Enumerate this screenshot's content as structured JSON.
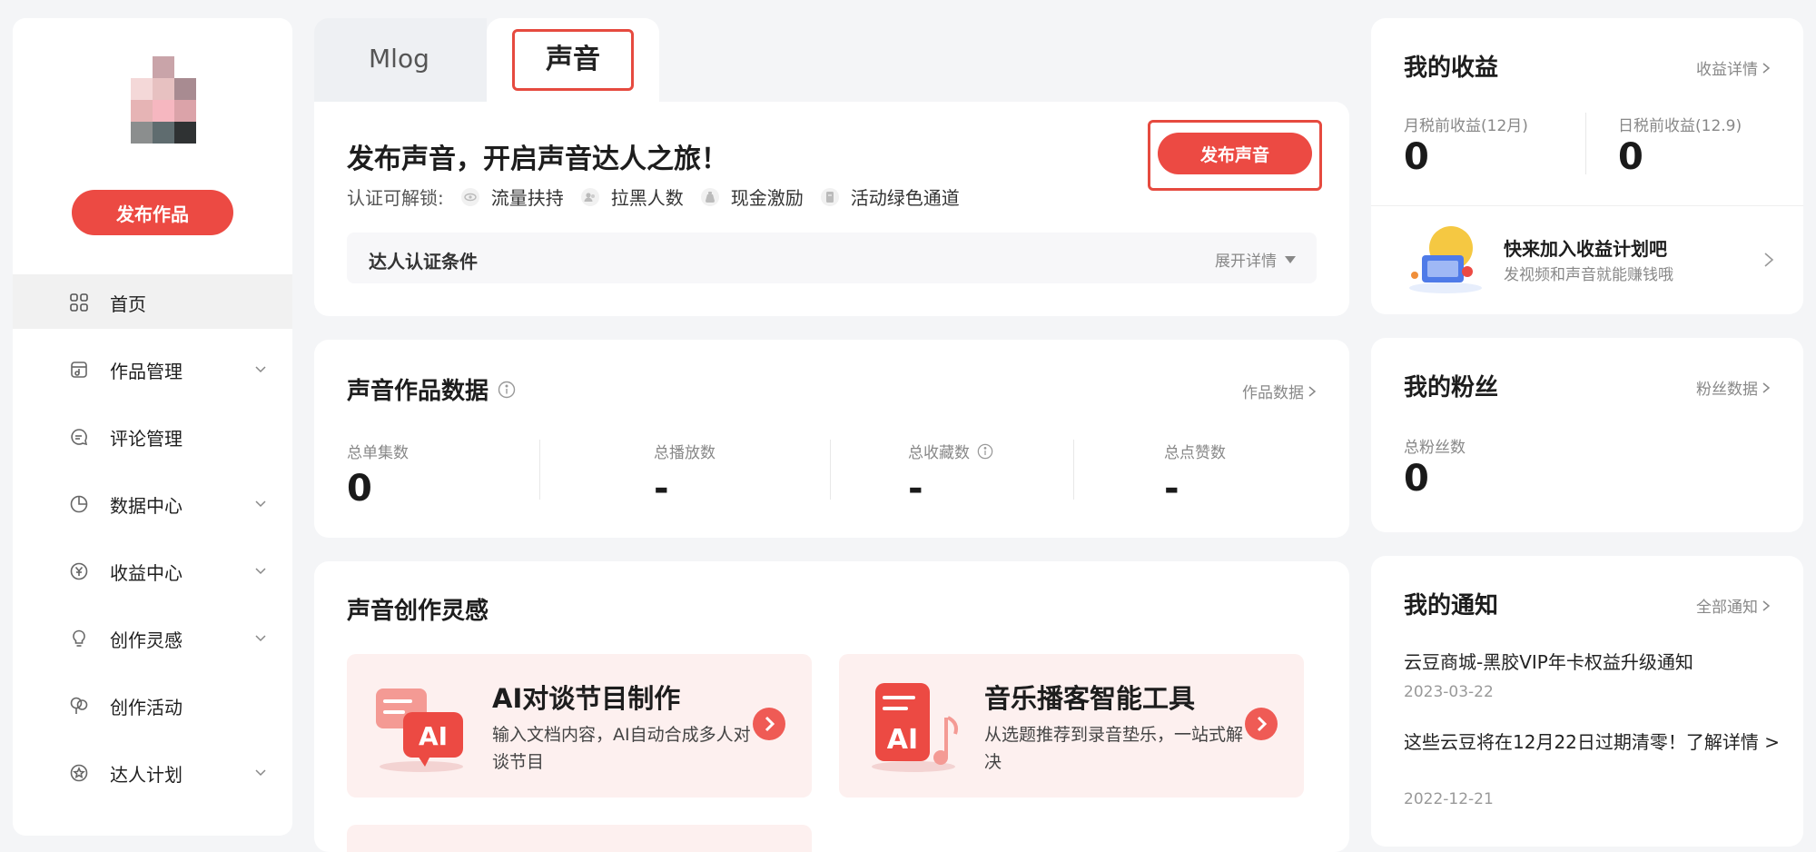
{
  "sidebar": {
    "publish_button": "发布作品",
    "items": [
      {
        "label": "首页",
        "icon": "grid-icon",
        "expandable": false,
        "active": true
      },
      {
        "label": "作品管理",
        "icon": "music-file-icon",
        "expandable": true,
        "active": false
      },
      {
        "label": "评论管理",
        "icon": "comment-icon",
        "expandable": false,
        "active": false
      },
      {
        "label": "数据中心",
        "icon": "pie-chart-icon",
        "expandable": true,
        "active": false
      },
      {
        "label": "收益中心",
        "icon": "yuan-icon",
        "expandable": true,
        "active": false
      },
      {
        "label": "创作灵感",
        "icon": "bulb-icon",
        "expandable": true,
        "active": false
      },
      {
        "label": "创作活动",
        "icon": "balloon-icon",
        "expandable": false,
        "active": false
      },
      {
        "label": "达人计划",
        "icon": "star-badge-icon",
        "expandable": true,
        "active": false
      }
    ]
  },
  "tabs": {
    "items": [
      "Mlog",
      "声音"
    ],
    "active": "声音"
  },
  "intro": {
    "title": "发布声音，开启声音达人之旅！",
    "unlock_label": "认证可解锁:",
    "perks": [
      "流量扶持",
      "拉黑人数",
      "现金激励",
      "活动绿色通道"
    ],
    "publish_button": "发布声音",
    "cert_label": "达人认证条件",
    "cert_expand": "展开详情"
  },
  "stats": {
    "title": "声音作品数据",
    "link": "作品数据",
    "items": [
      {
        "label": "总单集数",
        "value": "0"
      },
      {
        "label": "总播放数",
        "value": "-"
      },
      {
        "label": "总收藏数",
        "value": "-"
      },
      {
        "label": "总点赞数",
        "value": "-"
      }
    ]
  },
  "inspiration": {
    "title": "声音创作灵感",
    "cards": [
      {
        "title": "AI对谈节目制作",
        "desc": "输入文档内容，AI自动合成多人对谈节目",
        "art_text": "AI"
      },
      {
        "title": "音乐播客智能工具",
        "desc": "从选题推荐到录音垫乐，一站式解决",
        "art_text": "AI"
      }
    ]
  },
  "earnings": {
    "title": "我的收益",
    "link": "收益详情",
    "monthly_label": "月税前收益(12月)",
    "monthly_value": "0",
    "daily_label": "日税前收益(12.9)",
    "daily_value": "0",
    "plan_title": "快来加入收益计划吧",
    "plan_sub": "发视频和声音就能赚钱哦"
  },
  "fans": {
    "title": "我的粉丝",
    "link": "粉丝数据",
    "count_label": "总粉丝数",
    "count_value": "0"
  },
  "notices": {
    "title": "我的通知",
    "link": "全部通知",
    "items": [
      {
        "title": "云豆商城-黑胶VIP年卡权益升级通知",
        "date": "2023-03-22"
      },
      {
        "title": "这些云豆将在12月22日过期清零！了解详情 >",
        "date": "2022-12-21"
      }
    ]
  },
  "colors": {
    "accent": "#ec4a43",
    "highlight_frame": "#e64a3f",
    "background": "#f4f5f7",
    "inspiration_card": "#fdf0ef"
  }
}
